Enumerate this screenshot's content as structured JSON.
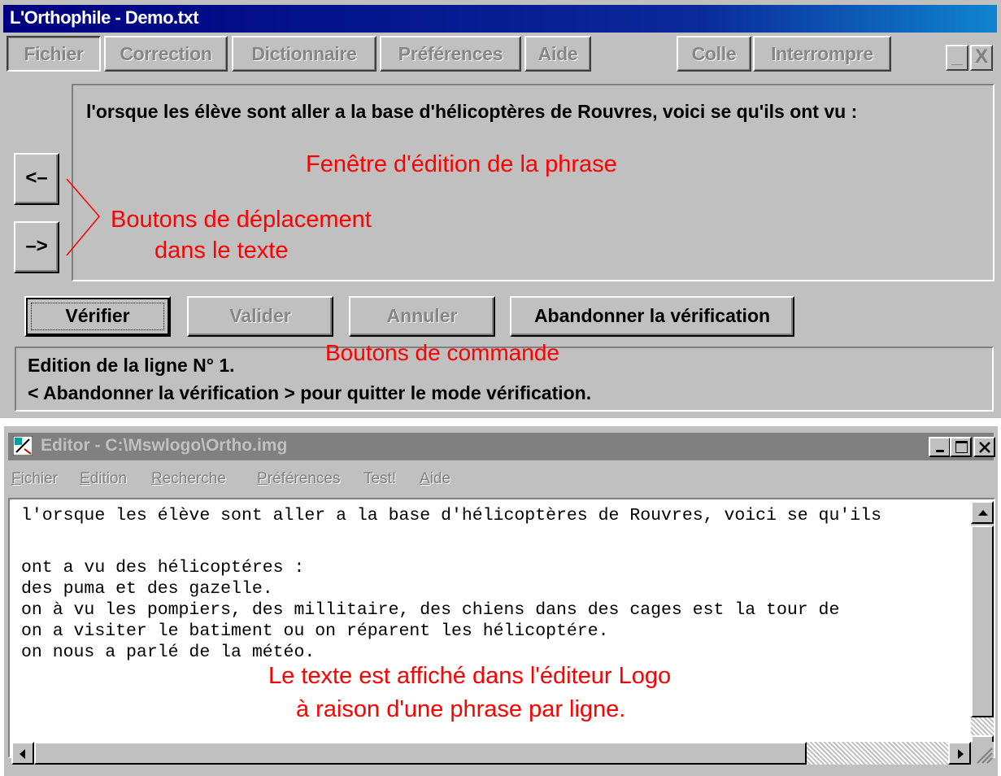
{
  "ortho_window": {
    "title": "L'Orthophile - Demo.txt",
    "menu": [
      "Fichier",
      "Correction",
      "Dictionnaire",
      "Préférences",
      "Aide"
    ],
    "right_buttons": [
      "Colle",
      "Interrompre"
    ],
    "minimize_label": "_",
    "close_label": "X",
    "sentence": "l'orsque les élève sont aller a la base d'hélicoptères de Rouvres, voici se qu'ils ont vu :",
    "nav_prev": "<–",
    "nav_next": "–>",
    "commands": {
      "verify": "Vérifier",
      "validate": "Valider",
      "cancel": "Annuler",
      "abandon": "Abandonner la vérification"
    },
    "status": {
      "line1": "Edition de la ligne N° 1.",
      "line2": "< Abandonner la vérification > pour quitter le mode vérification."
    }
  },
  "annotations": {
    "edit_window": "Fenêtre d'édition de la phrase",
    "nav_buttons_1": "Boutons de déplacement",
    "nav_buttons_2": "dans le texte",
    "command_buttons": "Boutons de commande",
    "editor_note_1": "Le texte est affiché dans l'éditeur Logo",
    "editor_note_2": "à raison d'une phrase par ligne.",
    "color": "#ff0000"
  },
  "editor_window": {
    "title": "Editor - C:\\Mswlogo\\Ortho.img",
    "menu": [
      {
        "first": "F",
        "rest": "ichier"
      },
      {
        "first": "E",
        "rest": "dition"
      },
      {
        "first": "R",
        "rest": "echerche"
      },
      {
        "first": "P",
        "rest": "références"
      },
      {
        "first": "",
        "rest": "Test!"
      },
      {
        "first": "A",
        "rest": "ide"
      }
    ],
    "lines": [
      "l'orsque les élève sont aller a la base d'hélicoptères de Rouvres, voici se qu'ils",
      "",
      "ont a vu des hélicoptéres :",
      "des puma et des gazelle.",
      "on à vu les pompiers, des millitaire, des chiens dans des cages est la tour de",
      "on a visiter le batiment ou on réparent les hélicoptére.",
      "on nous a parlé de la météo."
    ]
  }
}
